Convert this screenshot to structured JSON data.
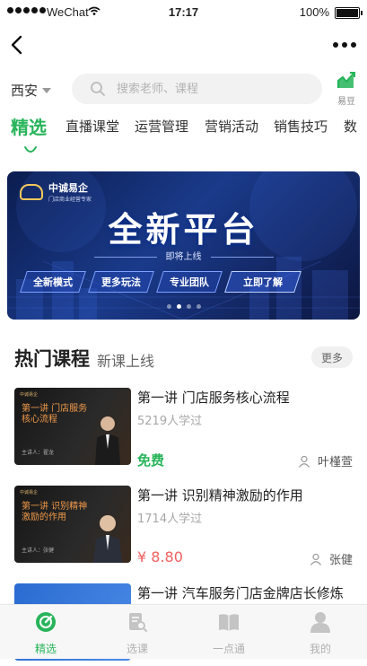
{
  "status_bar": {
    "carrier": "WeChat",
    "time": "17:17",
    "battery": "100%"
  },
  "search": {
    "city": "西安",
    "placeholder": "搜索老师、课程",
    "beans_label": "易豆"
  },
  "category_tabs": [
    {
      "label": "精选",
      "active": true
    },
    {
      "label": "直播课堂"
    },
    {
      "label": "运营管理"
    },
    {
      "label": "营销活动"
    },
    {
      "label": "销售技巧"
    },
    {
      "label": "数"
    }
  ],
  "banner": {
    "logo_text": "中诚易企",
    "logo_sub": "门店商业经营专家",
    "headline": "全新平台",
    "subline": "即将上线",
    "pills": [
      "全新模式",
      "更多玩法",
      "专业团队"
    ],
    "cta": "立即了解",
    "slide_count": 4,
    "active_slide": 1
  },
  "section": {
    "title": "热门课程",
    "subtitle": "新课上线",
    "more": "更多"
  },
  "courses": [
    {
      "title": "第一讲 门店服务核心流程",
      "learners": "5219人学过",
      "price": "免费",
      "teacher": "叶槿萱",
      "thumb_title": "第一讲 门店服务核心流程",
      "thumb_speaker": "主讲人：翟龙"
    },
    {
      "title": "第一讲 识别精神激励的作用",
      "learners": "1714人学过",
      "price": "¥  8.80",
      "teacher": "张健",
      "thumb_title": "第一讲 识别精神激励的作用",
      "thumb_speaker": "主讲人：张健"
    },
    {
      "title": "第一讲 汽车服务门店金牌店长修炼"
    }
  ],
  "bottom_tabs": [
    {
      "label": "精选",
      "icon": "compass-icon",
      "active": true
    },
    {
      "label": "选课",
      "icon": "course-search-icon"
    },
    {
      "label": "一点通",
      "icon": "book-icon"
    },
    {
      "label": "我的",
      "icon": "user-icon"
    }
  ],
  "colors": {
    "accent": "#27b45a",
    "price": "#f06060",
    "banner_bg": "#0b1d4f"
  }
}
